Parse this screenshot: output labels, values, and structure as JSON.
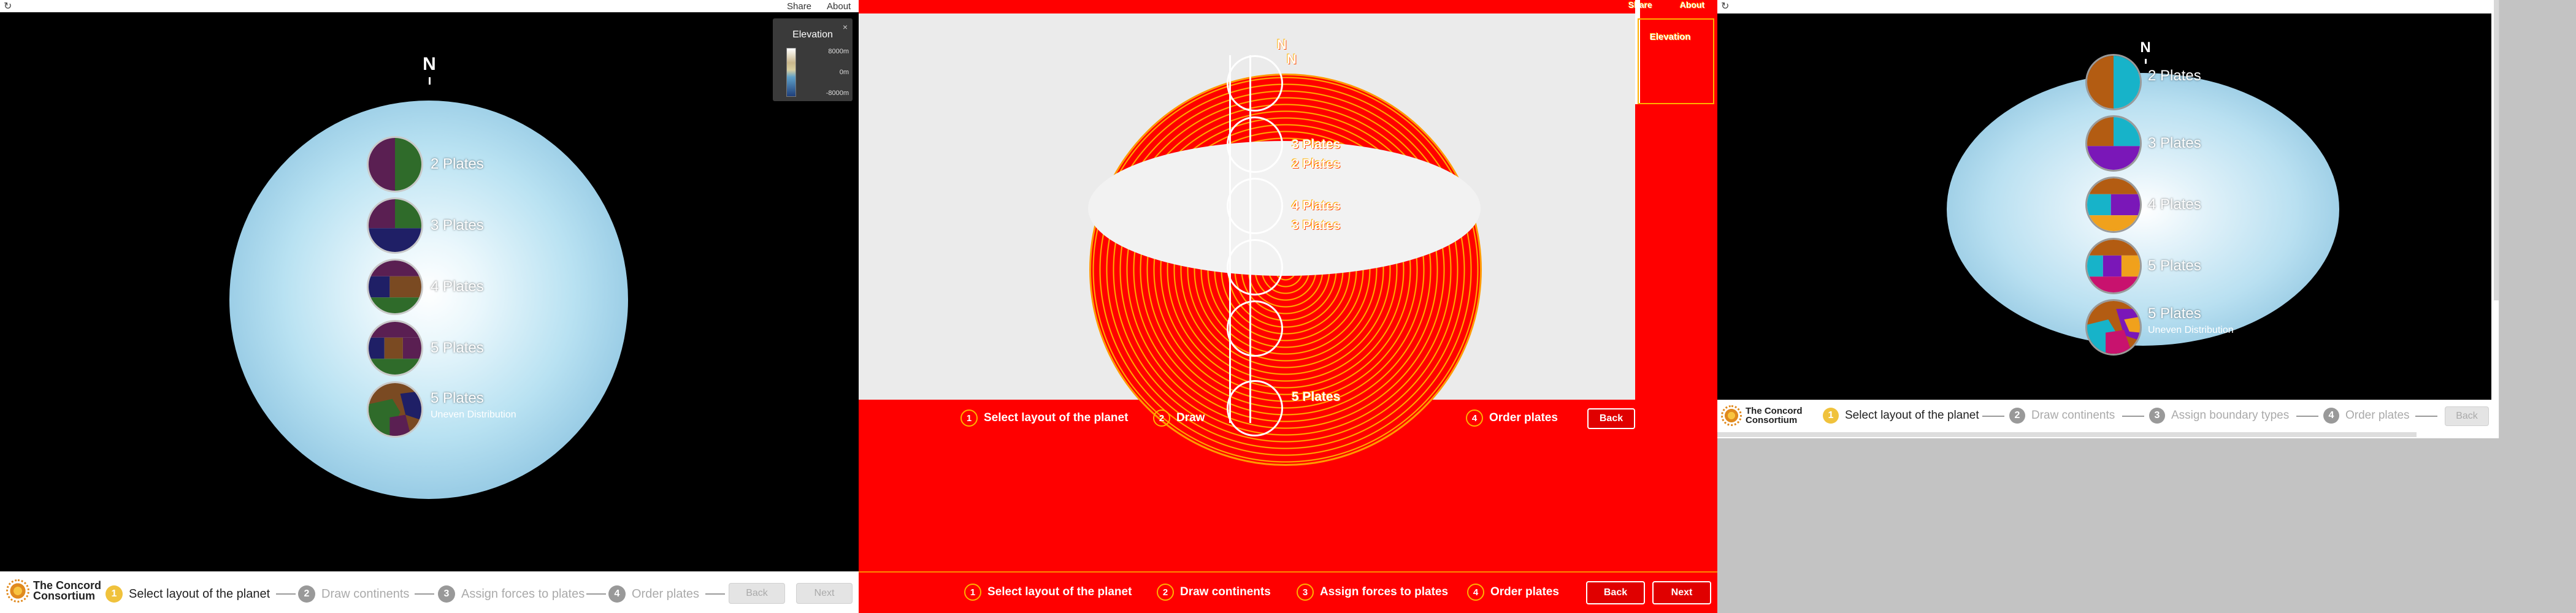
{
  "panel1": {
    "top_links": [
      "Share",
      "About"
    ],
    "compass": "N",
    "legend": {
      "title": "Elevation",
      "close": "×",
      "values": [
        "8000m",
        "0m",
        "-8000m"
      ]
    },
    "options": [
      {
        "label": "2 Plates",
        "sublabel": ""
      },
      {
        "label": "3 Plates",
        "sublabel": ""
      },
      {
        "label": "4 Plates",
        "sublabel": ""
      },
      {
        "label": "5 Plates",
        "sublabel": ""
      },
      {
        "label": "5 Plates",
        "sublabel": "Uneven Distribution"
      }
    ],
    "logo": {
      "line1": "The Concord",
      "line2": "Consortium"
    },
    "steps": [
      {
        "num": "1",
        "label": "Select layout of the planet"
      },
      {
        "num": "2",
        "label": "Draw continents"
      },
      {
        "num": "3",
        "label": "Assign forces to plates"
      },
      {
        "num": "4",
        "label": "Order plates"
      }
    ],
    "back": "Back",
    "next": "Next"
  },
  "panel2": {
    "top_links": [
      "Share",
      "About"
    ],
    "compass": "N",
    "legend_title": "Elevation",
    "plate_labels": [
      "3 Plates",
      "2 Plates",
      "4 Plates",
      "3 Plates",
      "5 Plates"
    ],
    "mid_steps": [
      {
        "num": "1",
        "label": "Select layout of the planet"
      },
      {
        "num": "2",
        "label": "Draw"
      },
      {
        "num": "4",
        "label": "Order plates"
      }
    ],
    "mid_back": "Back",
    "steps": [
      {
        "num": "1",
        "label": "Select layout of the planet"
      },
      {
        "num": "2",
        "label": "Draw continents"
      },
      {
        "num": "3",
        "label": "Assign forces to plates"
      },
      {
        "num": "4",
        "label": "Order plates"
      }
    ],
    "back": "Back",
    "next": "Next"
  },
  "panel3": {
    "compass": "N",
    "options": [
      {
        "label": "2 Plates",
        "sublabel": ""
      },
      {
        "label": "3 Plates",
        "sublabel": ""
      },
      {
        "label": "4 Plates",
        "sublabel": ""
      },
      {
        "label": "5 Plates",
        "sublabel": ""
      },
      {
        "label": "5 Plates",
        "sublabel": "Uneven Distribution"
      }
    ],
    "logo": {
      "line1": "The Concord",
      "line2": "Consortium"
    },
    "steps": [
      {
        "num": "1",
        "label": "Select layout of the planet"
      },
      {
        "num": "2",
        "label": "Draw continents"
      },
      {
        "num": "3",
        "label": "Assign boundary types"
      },
      {
        "num": "4",
        "label": "Order plates"
      }
    ],
    "back": "Back"
  },
  "colors": {
    "accent": "#f0c23c",
    "plate_dark_a": "#5a1f52",
    "plate_dark_b": "#2f6b2a",
    "plate_dark_c": "#1f1f66",
    "plate_dark_d": "#7a4a22",
    "plate_a": "#b35c12",
    "plate_b": "#17b3c9",
    "plate_c": "#7a17b8",
    "plate_d": "#f0a11c",
    "plate_e": "#c8126e"
  }
}
